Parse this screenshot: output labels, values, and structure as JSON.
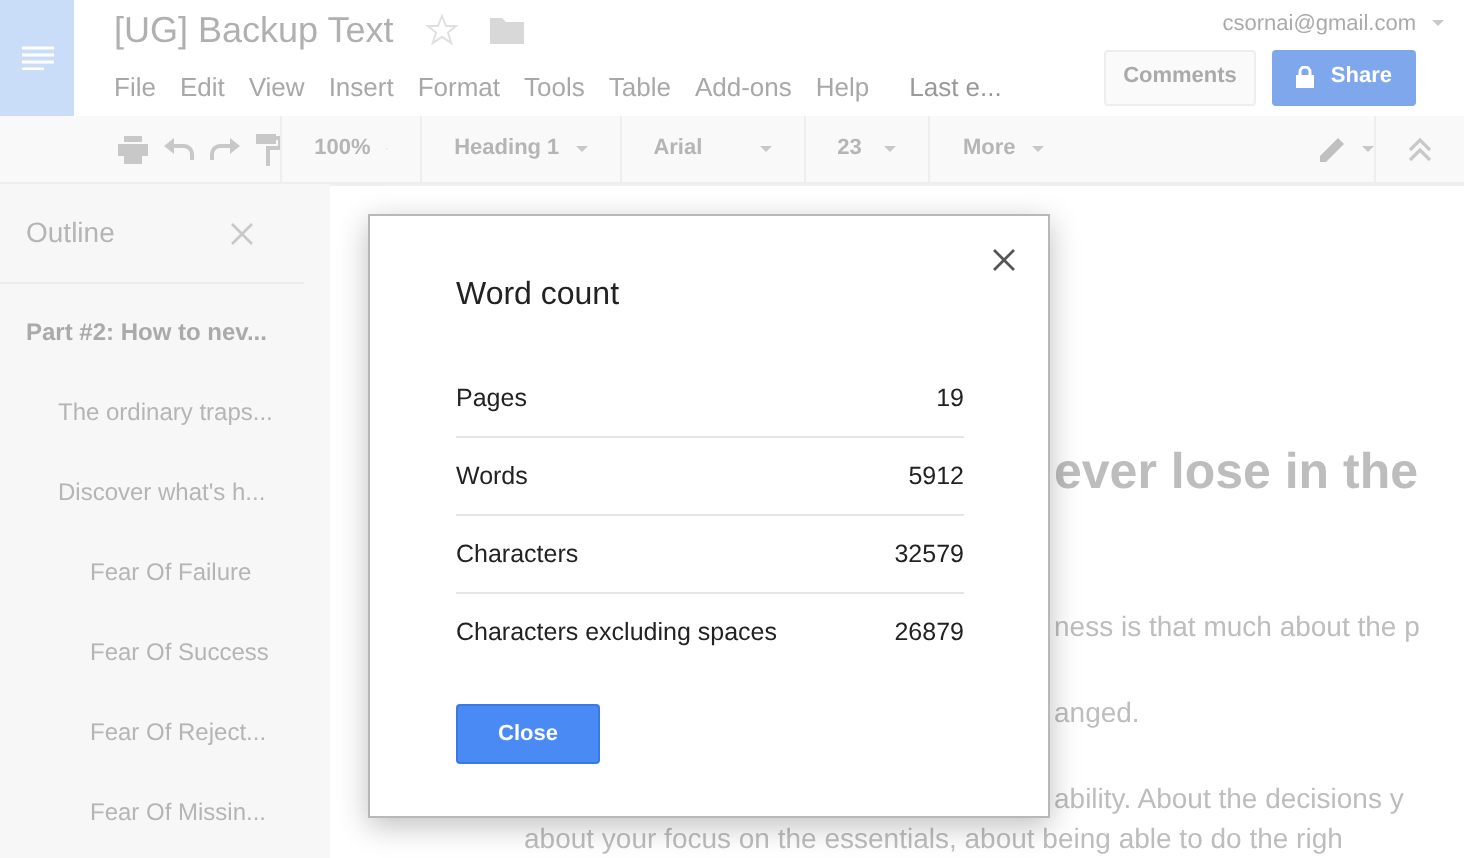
{
  "document": {
    "title": "[UG] Backup Text"
  },
  "account": {
    "email": "csornai@gmail.com"
  },
  "menu": [
    "File",
    "Edit",
    "View",
    "Insert",
    "Format",
    "Tools",
    "Table",
    "Add-ons",
    "Help"
  ],
  "last_edit": "Last e...",
  "buttons": {
    "comments": "Comments",
    "share": "Share"
  },
  "toolbar": {
    "zoom": "100%",
    "style": "Heading 1",
    "font": "Arial",
    "size": "23",
    "more": "More"
  },
  "outline": {
    "title": "Outline",
    "items": [
      {
        "label": "Part #2: How to nev...",
        "children": [
          {
            "label": "The ordinary traps..."
          },
          {
            "label": "Discover what's h...",
            "children": [
              {
                "label": "Fear Of Failure"
              },
              {
                "label": "Fear Of Success"
              },
              {
                "label": "Fear Of Reject..."
              },
              {
                "label": "Fear Of Missin..."
              }
            ]
          }
        ]
      }
    ]
  },
  "page_text": [
    {
      "kind": "heading",
      "text": "ever lose in the"
    },
    {
      "kind": "paragraph",
      "text": "ness is that much about the p"
    },
    {
      "kind": "paragraph",
      "text": "anged."
    },
    {
      "kind": "paragraph",
      "text": "ability. About the decisions y"
    },
    {
      "kind": "line",
      "text": "about your focus on the essentials, about being able to do the righ"
    }
  ],
  "dialog": {
    "title": "Word count",
    "rows": [
      {
        "label": "Pages",
        "value": "19"
      },
      {
        "label": "Words",
        "value": "5912"
      },
      {
        "label": "Characters",
        "value": "32579"
      },
      {
        "label": "Characters excluding spaces",
        "value": "26879"
      }
    ],
    "button": "Close"
  }
}
